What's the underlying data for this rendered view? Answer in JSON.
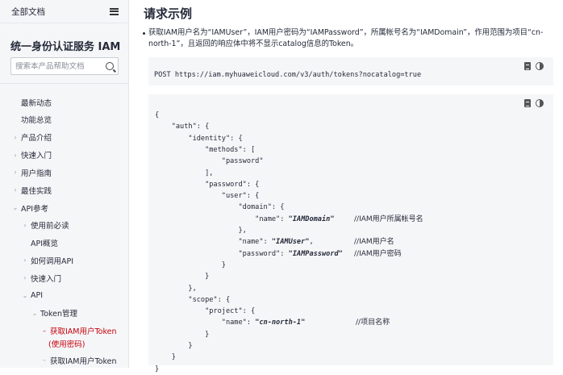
{
  "sidebar": {
    "header": "全部文档",
    "title": "统一身份认证服务 IAM",
    "search_placeholder": "搜索本产品帮助文档",
    "nav": [
      {
        "label": "最新动态",
        "indent": 0,
        "chevron": "",
        "active": false
      },
      {
        "label": "功能总览",
        "indent": 0,
        "chevron": "",
        "active": false
      },
      {
        "label": "产品介绍",
        "indent": 0,
        "chevron": ">",
        "active": false
      },
      {
        "label": "快速入门",
        "indent": 0,
        "chevron": ">",
        "active": false
      },
      {
        "label": "用户指南",
        "indent": 0,
        "chevron": ">",
        "active": false
      },
      {
        "label": "最佳实践",
        "indent": 0,
        "chevron": ">",
        "active": false
      },
      {
        "label": "API参考",
        "indent": 0,
        "chevron": "v",
        "active": false
      },
      {
        "label": "使用前必读",
        "indent": 1,
        "chevron": ">",
        "active": false
      },
      {
        "label": "API概览",
        "indent": 1,
        "chevron": "",
        "active": false
      },
      {
        "label": "如何调用API",
        "indent": 1,
        "chevron": ">",
        "active": false
      },
      {
        "label": "快速入门",
        "indent": 1,
        "chevron": ">",
        "active": false
      },
      {
        "label": "API",
        "indent": 1,
        "chevron": "v",
        "active": false
      },
      {
        "label": "Token管理",
        "indent": 2,
        "chevron": "v",
        "active": false
      },
      {
        "label": "获取IAM用户Token",
        "label2": "(使用密码)",
        "indent": 3,
        "chevron": "-",
        "active": true
      },
      {
        "label": "获取IAM用户Token",
        "indent": 3,
        "chevron": "-",
        "active": false
      }
    ]
  },
  "main": {
    "heading": "请求示例",
    "description": "获取IAM用户名为“IAMUser”，IAM用户密码为“IAMPassword”，所属帐号名为“IAMDomain”，作用范围为项目“cn-north-1”，且返回的响应体中将不显示catalog信息的Token。",
    "request_line": "POST https://iam.myhuaweicloud.com/v3/auth/tokens?nocatalog=true",
    "code_lines": [
      {
        "text": "{"
      },
      {
        "text": "    \"auth\": {"
      },
      {
        "text": "        \"identity\": {"
      },
      {
        "text": "            \"methods\": ["
      },
      {
        "text": "                \"password\""
      },
      {
        "text": "            ],"
      },
      {
        "text": "            \"password\": {"
      },
      {
        "text": "                \"user\": {"
      },
      {
        "text": "                    \"domain\": {"
      },
      {
        "text": "                        \"name\": ",
        "value": "\"IAMDomain\"",
        "comment": "//IAM用户所属帐号名"
      },
      {
        "text": "                    },"
      },
      {
        "text": "                    \"name\": ",
        "value": "\"IAMUser\"",
        "tail": ",",
        "comment": "//IAM用户名"
      },
      {
        "text": "                    \"password\": ",
        "value": "\"IAMPassword\"",
        "comment": "//IAM用户密码"
      },
      {
        "text": "                }"
      },
      {
        "text": "            }"
      },
      {
        "text": "        },"
      },
      {
        "text": "        \"scope\": {"
      },
      {
        "text": "            \"project\": {"
      },
      {
        "text": "                \"name\": ",
        "value": "\"cn-north-1\"",
        "comment": "//项目名称"
      },
      {
        "text": "            }"
      },
      {
        "text": "        }"
      },
      {
        "text": "    }"
      },
      {
        "text": "}"
      }
    ]
  },
  "icons": {
    "copy": "document-icon",
    "theme": "theme-toggle-icon"
  },
  "colors": {
    "active": "#c7000b",
    "code_bg": "#f5f6f8",
    "sidebar_bg": "#f5f6f8"
  }
}
